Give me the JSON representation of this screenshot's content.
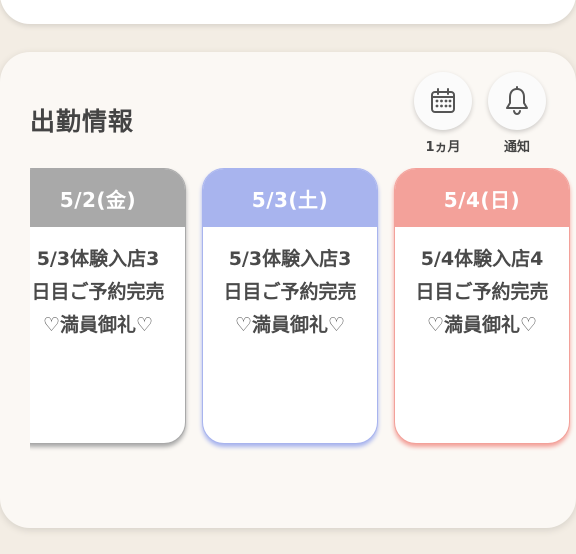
{
  "section": {
    "title": "出勤情報"
  },
  "actions": {
    "month_label": "1ヵ月",
    "notify_label": "通知"
  },
  "schedule": [
    {
      "date": "5/2(金)",
      "text": "5/3体験入店3\n日目ご予約完売\n♡満員御礼♡",
      "color": "#a9a9a9"
    },
    {
      "date": "5/3(土)",
      "text": "5/3体験入店3\n日目ご予約完売\n♡満員御礼♡",
      "color": "#a8b4ee"
    },
    {
      "date": "5/4(日)",
      "text": "5/4体験入店4\n日目ご予約完売\n♡満員御礼♡",
      "color": "#f3a19a"
    }
  ]
}
